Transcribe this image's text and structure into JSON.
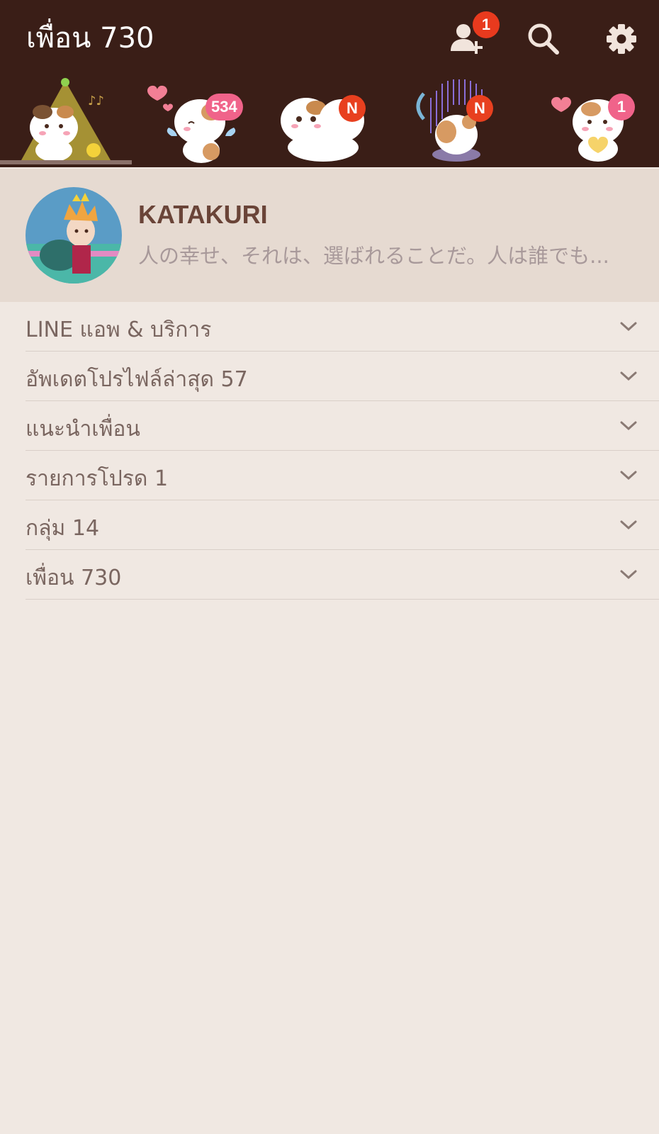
{
  "header": {
    "title": "เพื่อน 730",
    "add_friend_badge": "1",
    "icons": [
      "add-friend-icon",
      "search-icon",
      "settings-icon"
    ]
  },
  "sticker_tabs": [
    {
      "name": "party-hamster",
      "badge": "",
      "active": true
    },
    {
      "name": "angel-hamster",
      "badge": "534",
      "badge_color": "#f0638a"
    },
    {
      "name": "hug-hamsters",
      "badge": "N",
      "badge_color": "#e8401f"
    },
    {
      "name": "music-hamster",
      "badge": "N",
      "badge_color": "#e8401f"
    },
    {
      "name": "heart-hamster",
      "badge": "1",
      "badge_color": "#f0638a"
    }
  ],
  "profile": {
    "name": "KATAKURI",
    "status": "人の幸せ、それは、選ばれることだ。人は誰でも..."
  },
  "sections": [
    {
      "label": "LINE แอพ & บริการ"
    },
    {
      "label": "อัพเดตโปรไฟล์ล่าสุด 57"
    },
    {
      "label": "แนะนำเพื่อน"
    },
    {
      "label": "รายการโปรด 1"
    },
    {
      "label": "กลุ่ม 14"
    },
    {
      "label": "เพื่อน 730"
    }
  ],
  "colors": {
    "header_bg": "#3a1e17",
    "page_bg": "#f0e8e2",
    "profile_bg": "#e6dad1",
    "badge_red": "#e8401f",
    "badge_pink": "#f0638a"
  }
}
